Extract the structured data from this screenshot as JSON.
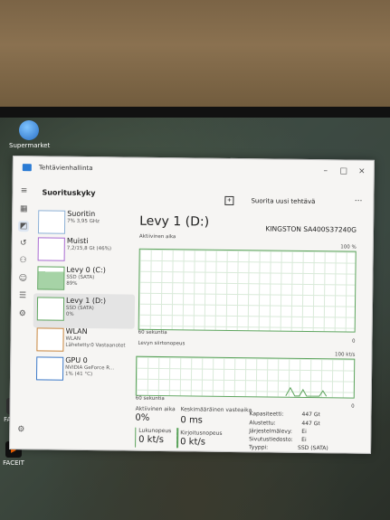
{
  "desktop": {
    "icons": [
      {
        "label": "Supermarket"
      },
      {
        "label": "FACEIT AC"
      },
      {
        "label": "FACEIT"
      }
    ]
  },
  "window": {
    "title": "Tehtävienhallinta",
    "section_title": "Suorituskyky",
    "run_task_label": "Suorita uusi tehtävä",
    "more_label": "···",
    "controls": {
      "minimize": "–",
      "maximize": "□",
      "close": "×"
    }
  },
  "devices": [
    {
      "name": "Suoritin",
      "sub": "7% 3,95 GHz"
    },
    {
      "name": "Muisti",
      "sub": "7,2/15,8 Gt (46%)"
    },
    {
      "name": "Levy 0 (C:)",
      "sub": "SSD (SATA)\n89%"
    },
    {
      "name": "Levy 1 (D:)",
      "sub": "SSD (SATA)\n0%"
    },
    {
      "name": "WLAN",
      "sub": "WLAN\nLähetetty:0 Vastaanotet"
    },
    {
      "name": "GPU 0",
      "sub": "NVIDIA GeForce R...\n1% (41 °C)"
    }
  ],
  "detail": {
    "title": "Levy 1 (D:)",
    "model": "KINGSTON SA400S37240G",
    "graph1": {
      "label": "Aktiivinen aika",
      "max": "100 %",
      "time": "60 sekuntia",
      "min": "0"
    },
    "graph2": {
      "label": "Levyn siirtonopeus",
      "max": "100 kt/s",
      "time": "60 sekuntia",
      "min": "0"
    },
    "stats": {
      "active_time_label": "Aktiivinen aika",
      "active_time_value": "0%",
      "response_label": "Keskimääräinen vasteaika",
      "response_value": "0 ms",
      "read_label": "Lukunopeus",
      "read_value": "0 kt/s",
      "write_label": "Kirjoitusnopeus",
      "write_value": "0 kt/s"
    },
    "properties": [
      {
        "k": "Kapasiteetti:",
        "v": "447 Gt"
      },
      {
        "k": "Alustettu:",
        "v": "447 Gt"
      },
      {
        "k": "Järjestelmälevy:",
        "v": "Ei"
      },
      {
        "k": "Sivutustiedosto:",
        "v": "Ei"
      },
      {
        "k": "Tyyppi:",
        "v": "SSD (SATA)"
      }
    ]
  },
  "colors": {
    "accent": "#2a7bd4",
    "disk_green": "#5da45d"
  }
}
